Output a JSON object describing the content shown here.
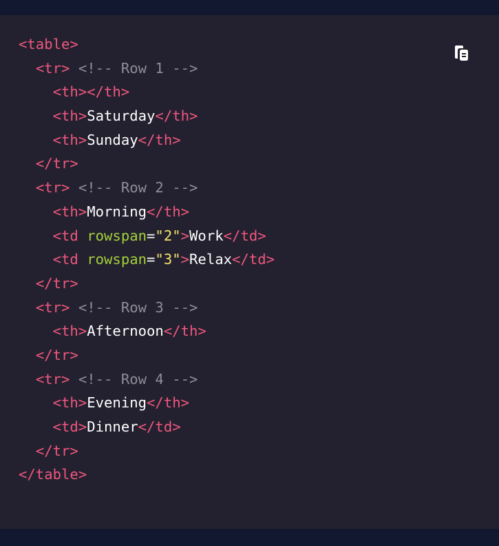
{
  "copy_button": {
    "icon": "clipboard-copy-icon"
  },
  "lines": [
    {
      "indent": "",
      "parts": [
        {
          "t": "tag",
          "v": "<table>"
        }
      ]
    },
    {
      "indent": "  ",
      "parts": [
        {
          "t": "tag",
          "v": "<tr>"
        },
        {
          "t": "pun",
          "v": " "
        },
        {
          "t": "comment",
          "v": "<!-- Row 1 -->"
        }
      ]
    },
    {
      "indent": "    ",
      "parts": [
        {
          "t": "tag",
          "v": "<th></th>"
        }
      ]
    },
    {
      "indent": "    ",
      "parts": [
        {
          "t": "tag",
          "v": "<th>"
        },
        {
          "t": "txt",
          "v": "Saturday"
        },
        {
          "t": "tag",
          "v": "</th>"
        }
      ]
    },
    {
      "indent": "    ",
      "parts": [
        {
          "t": "tag",
          "v": "<th>"
        },
        {
          "t": "txt",
          "v": "Sunday"
        },
        {
          "t": "tag",
          "v": "</th>"
        }
      ]
    },
    {
      "indent": "  ",
      "parts": [
        {
          "t": "tag",
          "v": "</tr>"
        }
      ]
    },
    {
      "indent": "  ",
      "parts": [
        {
          "t": "tag",
          "v": "<tr>"
        },
        {
          "t": "pun",
          "v": " "
        },
        {
          "t": "comment",
          "v": "<!-- Row 2 -->"
        }
      ]
    },
    {
      "indent": "    ",
      "parts": [
        {
          "t": "tag",
          "v": "<th>"
        },
        {
          "t": "txt",
          "v": "Morning"
        },
        {
          "t": "tag",
          "v": "</th>"
        }
      ]
    },
    {
      "indent": "    ",
      "parts": [
        {
          "t": "tag",
          "v": "<td "
        },
        {
          "t": "attr",
          "v": "rowspan"
        },
        {
          "t": "pun",
          "v": "="
        },
        {
          "t": "str",
          "v": "\"2\""
        },
        {
          "t": "tag",
          "v": ">"
        },
        {
          "t": "txt",
          "v": "Work"
        },
        {
          "t": "tag",
          "v": "</td>"
        }
      ]
    },
    {
      "indent": "    ",
      "parts": [
        {
          "t": "tag",
          "v": "<td "
        },
        {
          "t": "attr",
          "v": "rowspan"
        },
        {
          "t": "pun",
          "v": "="
        },
        {
          "t": "str",
          "v": "\"3\""
        },
        {
          "t": "tag",
          "v": ">"
        },
        {
          "t": "txt",
          "v": "Relax"
        },
        {
          "t": "tag",
          "v": "</td>"
        }
      ]
    },
    {
      "indent": "  ",
      "parts": [
        {
          "t": "tag",
          "v": "</tr>"
        }
      ]
    },
    {
      "indent": "  ",
      "parts": [
        {
          "t": "tag",
          "v": "<tr>"
        },
        {
          "t": "pun",
          "v": " "
        },
        {
          "t": "comment",
          "v": "<!-- Row 3 -->"
        }
      ]
    },
    {
      "indent": "    ",
      "parts": [
        {
          "t": "tag",
          "v": "<th>"
        },
        {
          "t": "txt",
          "v": "Afternoon"
        },
        {
          "t": "tag",
          "v": "</th>"
        }
      ]
    },
    {
      "indent": "  ",
      "parts": [
        {
          "t": "tag",
          "v": "</tr>"
        }
      ]
    },
    {
      "indent": "  ",
      "parts": [
        {
          "t": "tag",
          "v": "<tr>"
        },
        {
          "t": "pun",
          "v": " "
        },
        {
          "t": "comment",
          "v": "<!-- Row 4 -->"
        }
      ]
    },
    {
      "indent": "    ",
      "parts": [
        {
          "t": "tag",
          "v": "<th>"
        },
        {
          "t": "txt",
          "v": "Evening"
        },
        {
          "t": "tag",
          "v": "</th>"
        }
      ]
    },
    {
      "indent": "    ",
      "parts": [
        {
          "t": "tag",
          "v": "<td>"
        },
        {
          "t": "txt",
          "v": "Dinner"
        },
        {
          "t": "tag",
          "v": "</td>"
        }
      ]
    },
    {
      "indent": "  ",
      "parts": [
        {
          "t": "tag",
          "v": "</tr>"
        }
      ]
    },
    {
      "indent": "",
      "parts": [
        {
          "t": "tag",
          "v": "</table>"
        }
      ]
    }
  ]
}
